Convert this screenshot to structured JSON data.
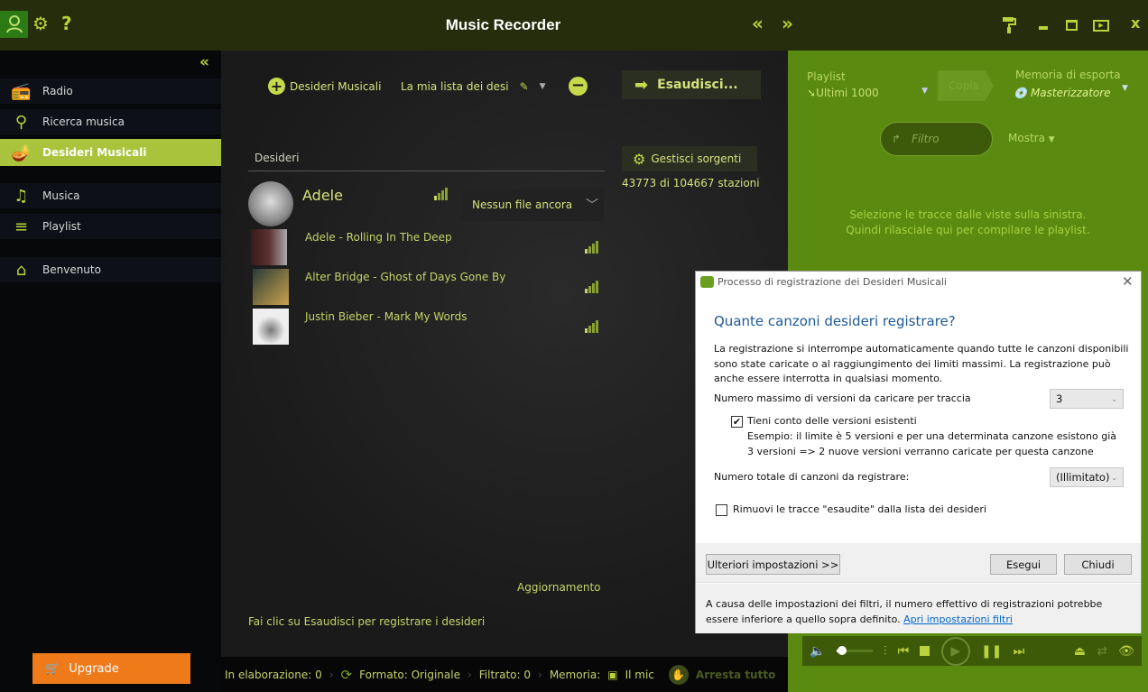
{
  "titlebar": {
    "title": "Music Recorder",
    "icons": [
      "user-icon",
      "gear-icon",
      "help-icon",
      "nav-back-icon",
      "nav-forward-icon",
      "paint-roller-icon",
      "minimize-icon",
      "maximize-icon",
      "mini-player-icon",
      "close-icon"
    ],
    "help": "?",
    "back": "«",
    "forward": "»",
    "close": "x"
  },
  "sidebar": {
    "collapse": "«",
    "items": [
      {
        "label": "Radio",
        "icon": "radio-icon"
      },
      {
        "label": "Ricerca musica",
        "icon": "search-icon"
      },
      {
        "label": "Desideri Musicali",
        "icon": "lamp-icon",
        "active": true
      },
      {
        "label": "Musica",
        "icon": "music-note-icon"
      },
      {
        "label": "Playlist",
        "icon": "playlist-icon"
      },
      {
        "label": "Benvenuto",
        "icon": "home-icon"
      }
    ],
    "upgrade": "Upgrade"
  },
  "main": {
    "add_label": "Desideri Musicali",
    "list_name": "La mia lista dei desi",
    "esaudisci": "Esaudisci...",
    "gestisci": "Gestisci sorgenti",
    "stations": "43773 di 104667 stazioni",
    "column": "Desideri",
    "artist": "Adele",
    "no_file": "Nessun file ancora",
    "tracks": [
      "Adele - Rolling In The Deep",
      "Alter Bridge - Ghost of Days Gone By",
      "Justin Bieber - Mark My Words"
    ],
    "update": "Aggiornamento",
    "hint": "Fai clic su Esaudisci per registrare i desideri"
  },
  "statusbar": {
    "processing": "In elaborazione: 0",
    "format": "Formato: Originale",
    "filtered": "Filtrato: 0",
    "memory": "Memoria:",
    "memory_value": "Il mic",
    "stop_all": "Arresta tutto"
  },
  "right": {
    "playlist_label": "Playlist",
    "playlist_value": "Ultimi 1000",
    "copy": "Copia",
    "export_label": "Memoria di esporta",
    "export_value": "Masterizzatore",
    "filter_placeholder": "Filtro",
    "show": "Mostra",
    "empty_line1": "Selezione le tracce dalle viste sulla sinistra.",
    "empty_line2": "Quindi rilasciale qui per compilare le playlist."
  },
  "player": {
    "volume": 0.15
  },
  "dialog": {
    "title": "Processo di registrazione dei Desideri Musicali",
    "heading": "Quante canzoni desideri registrare?",
    "intro": "La registrazione si interrompe automaticamente quando tutte le canzoni disponibili sono state caricate o al raggiungimento dei limiti massimi. La registrazione può anche essere interrotta in qualsiasi momento.",
    "max_versions_label": "Numero massimo di versioni da caricare per traccia",
    "max_versions_value": "3",
    "consider_existing_label": "Tieni conto delle versioni esistenti",
    "consider_existing_checked": true,
    "example": "Esempio: il limite è 5 versioni e per una determinata canzone esistono già 3 versioni => 2 nuove versioni verranno caricate per questa canzone",
    "total_label": "Numero totale di canzoni da registrare:",
    "total_value": "(Illimitato)",
    "remove_label": "Rimuovi le tracce \"esaudite\" dalla lista dei desideri",
    "remove_checked": false,
    "more_settings": "Ulteriori impostazioni >>",
    "run": "Esegui",
    "close": "Chiudi",
    "footer": "A causa delle impostazioni dei filtri, il numero effettivo di registrazioni potrebbe essere inferiore a quello sopra definito.",
    "footer_link": "Apri impostazioni filtri"
  },
  "colors": {
    "accent": "#a9c43c",
    "titlebar": "#262d0c",
    "right_panel": "#5a8a10",
    "upgrade": "#ef7a1a"
  }
}
